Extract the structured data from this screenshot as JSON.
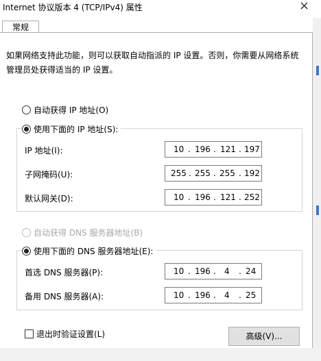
{
  "window": {
    "title": "Internet 协议版本 4 (TCP/IPv4) 属性",
    "close_glyph": "×"
  },
  "tabs": [
    {
      "label": "常规"
    }
  ],
  "description": "如果网络支持此功能，则可以获取自动指派的 IP 设置。否则，你需要从网络系统管理员处获得适当的 IP 设置。",
  "ip_section": {
    "auto_label": "自动获得 IP 地址(O)",
    "manual_label": "使用下面的 IP 地址(S):",
    "fields": [
      {
        "label": "IP 地址(I):",
        "octets": [
          "10",
          "196",
          "121",
          "197"
        ]
      },
      {
        "label": "子网掩码(U):",
        "octets": [
          "255",
          "255",
          "255",
          "192"
        ]
      },
      {
        "label": "默认网关(D):",
        "octets": [
          "10",
          "196",
          "121",
          "252"
        ]
      }
    ]
  },
  "dns_section": {
    "auto_label": "自动获得 DNS 服务器地址(B)",
    "manual_label": "使用下面的 DNS 服务器地址(E):",
    "fields": [
      {
        "label": "首选 DNS 服务器(P):",
        "octets": [
          "10",
          "196",
          "4",
          "24"
        ]
      },
      {
        "label": "备用 DNS 服务器(A):",
        "octets": [
          "10",
          "196",
          "4",
          "25"
        ]
      }
    ]
  },
  "validate_label": "退出时验证设置(L)",
  "advanced_button": "高级(V)...",
  "separator": "."
}
